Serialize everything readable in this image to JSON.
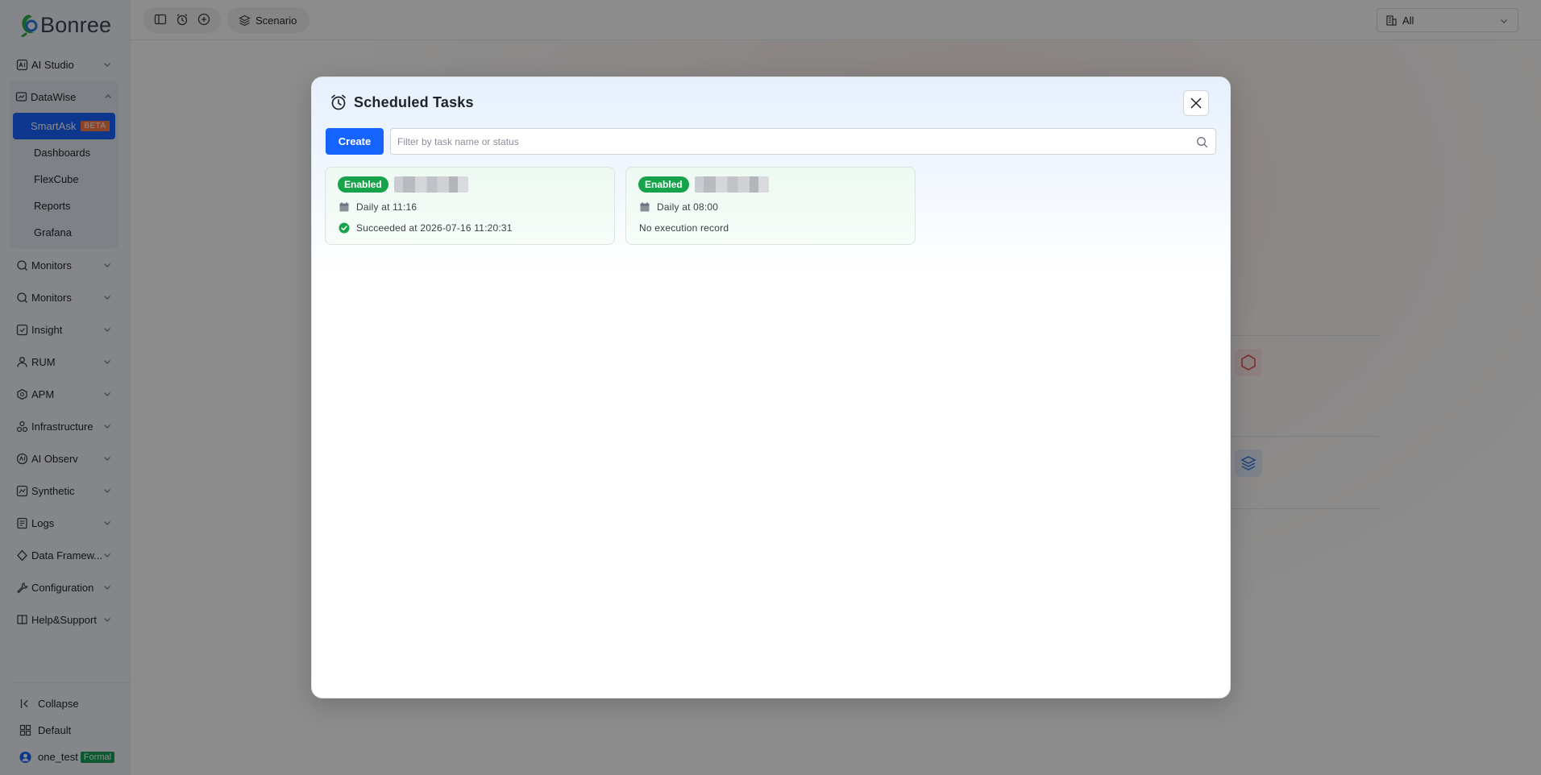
{
  "app": {
    "logo_text": "Bonree"
  },
  "sidebar": {
    "items": [
      {
        "label": "AI Studio",
        "icon": "ai-studio-icon"
      },
      {
        "label": "DataWise",
        "icon": "datawise-icon",
        "expanded": true,
        "children": [
          {
            "label": "SmartAsk",
            "badge": "BETA",
            "active": true
          },
          {
            "label": "Dashboards"
          },
          {
            "label": "FlexCube"
          },
          {
            "label": "Reports"
          },
          {
            "label": "Grafana"
          }
        ]
      },
      {
        "label": "Monitors",
        "icon": "monitors-icon"
      },
      {
        "label": "Monitors",
        "icon": "monitors-icon"
      },
      {
        "label": "Insight",
        "icon": "insight-icon"
      },
      {
        "label": "RUM",
        "icon": "rum-icon"
      },
      {
        "label": "APM",
        "icon": "apm-icon"
      },
      {
        "label": "Infrastructure",
        "icon": "infrastructure-icon"
      },
      {
        "label": "AI Observ",
        "icon": "ai-observ-icon"
      },
      {
        "label": "Synthetic",
        "icon": "synthetic-icon"
      },
      {
        "label": "Logs",
        "icon": "logs-icon"
      },
      {
        "label": "Data Framew...",
        "icon": "data-framework-icon"
      },
      {
        "label": "Configuration",
        "icon": "configuration-icon"
      },
      {
        "label": "Help&Support",
        "icon": "help-icon"
      }
    ],
    "bottom": {
      "collapse_label": "Collapse",
      "workspace_label": "Default",
      "user_name": "one_test",
      "user_badge": "Formal"
    }
  },
  "topbar": {
    "scenario_label": "Scenario",
    "filter_value": "All"
  },
  "modal": {
    "title": "Scheduled Tasks",
    "create_label": "Create",
    "search_placeholder": "Filter by task name or status",
    "tasks": [
      {
        "status": "Enabled",
        "schedule": "Daily at 11:16",
        "last_run": "Succeeded at 2026-07-16 11:20:31",
        "last_run_ok": true
      },
      {
        "status": "Enabled",
        "schedule": "Daily at 08:00",
        "last_run": "No execution record",
        "last_run_ok": false
      }
    ]
  },
  "colors": {
    "primary": "#1664ff",
    "success": "#16a34a",
    "beta_badge": "#ff7d4a",
    "formal_badge": "#18a058"
  }
}
